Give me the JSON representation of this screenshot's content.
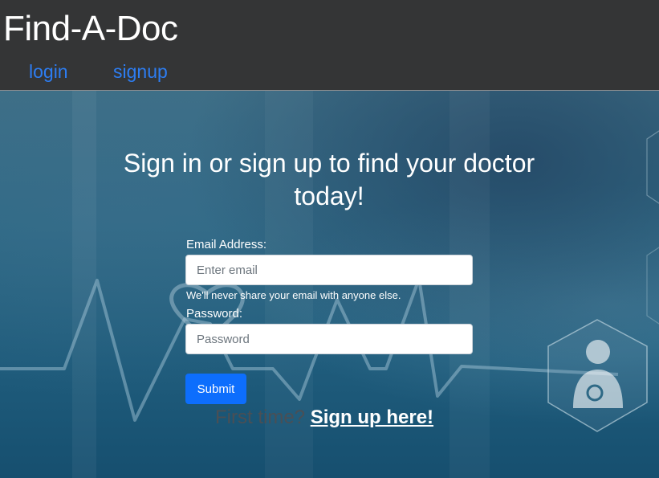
{
  "header": {
    "brand": "Find-A-Doc",
    "nav": {
      "login": "login",
      "signup": "signup"
    }
  },
  "hero": {
    "title": "Sign in or sign up to find your doctor today!"
  },
  "form": {
    "email_label": "Email Address:",
    "email_placeholder": "Enter email",
    "email_value": "",
    "email_help": "We'll never share your email with anyone else.",
    "password_label": "Password:",
    "password_placeholder": "Password",
    "password_value": "",
    "submit_label": "Submit"
  },
  "signup_prompt": {
    "text": "First time?",
    "link": "Sign up here!"
  },
  "colors": {
    "navbar_bg": "#343536",
    "nav_link": "#2d7df2",
    "primary_button": "#0d6efd",
    "hero_base": "#1f5c7c"
  },
  "icons": [
    "heartbeat-line",
    "heart-outline-icon",
    "doctor-icon",
    "hexagon-frame"
  ]
}
